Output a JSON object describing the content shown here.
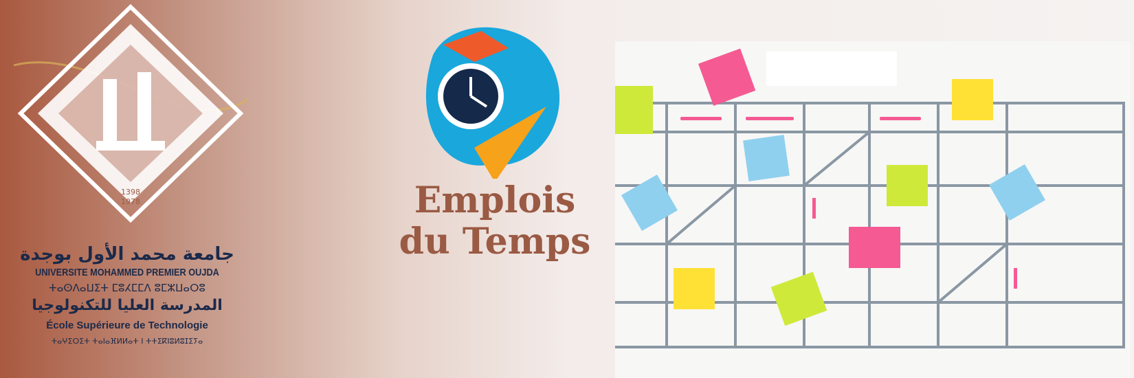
{
  "university": {
    "arabic_name": "جامعة محمد الأول بوجدة",
    "french_name": "UNIVERSITE MOHAMMED PREMIER OUJDA",
    "tifinagh_name": "ⵜⴰⵙⴷⴰⵡⵉⵜ ⵎⵓⵃⵎⵎⴷ ⵓⵎⵣⵡⴰⵔⵓ",
    "logo_years": [
      "1398",
      "1978"
    ]
  },
  "school": {
    "arabic_name": "المدرسة العليا للتكنولوجيا",
    "french_name": "École Supérieure de Technologie",
    "tifinagh_name": "ⵜⴰⵖⵉⵔⵉⵜ ⵜⴰⵏⴰⴼⵍⵍⴰⵜ ⵏ ⵜⵜⵉⴽⵏⵓⵍⵓⵊⵉⵢⴰ"
  },
  "title": {
    "line1": "Emplois",
    "line2": "du Temps"
  },
  "colors": {
    "brand": "#9a5a44",
    "navy": "#1c2a4a",
    "grid": "#8a97a3",
    "pink": "#f55a93",
    "yellow": "#ffe135",
    "lime": "#cfe93a",
    "blue": "#8fd0ee"
  }
}
